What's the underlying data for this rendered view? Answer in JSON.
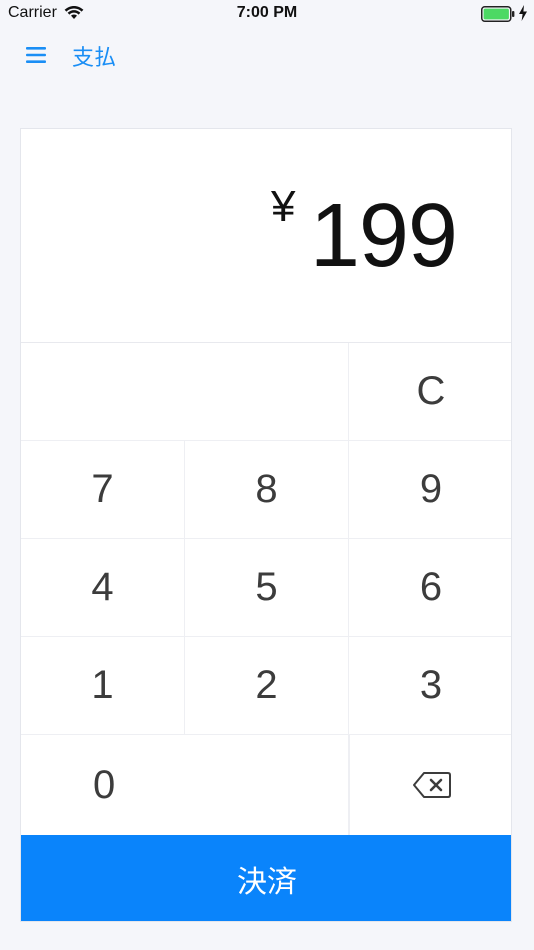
{
  "status_bar": {
    "carrier": "Carrier",
    "time": "7:00 PM",
    "wifi_icon": "wifi-icon",
    "battery_icon": "battery-icon",
    "charging_icon": "charging-bolt-icon",
    "battery_color": "#4cd964"
  },
  "nav": {
    "menu_icon": "hamburger-menu-icon",
    "title": "支払",
    "accent_color": "#1a8ef5"
  },
  "display": {
    "currency_symbol": "¥",
    "amount": "199"
  },
  "keypad": {
    "clear": "C",
    "digits": [
      "7",
      "8",
      "9",
      "4",
      "5",
      "6",
      "1",
      "2",
      "3"
    ],
    "zero": "0",
    "backspace_icon": "backspace-icon"
  },
  "pay_button": {
    "label": "決済",
    "color": "#0a84fb"
  }
}
